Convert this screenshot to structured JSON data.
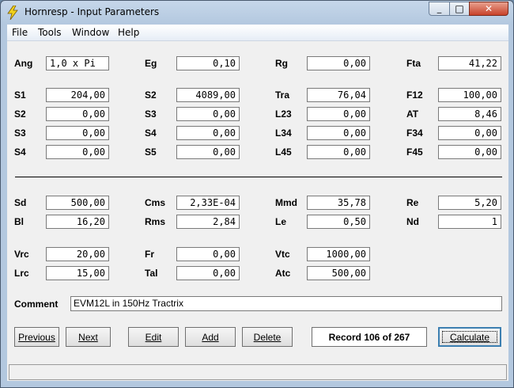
{
  "window": {
    "title": "Hornresp - Input Parameters",
    "close_symbol": "✕",
    "max_symbol": "□",
    "min_symbol": "_"
  },
  "menu": [
    "File",
    "Tools",
    "Window",
    "Help"
  ],
  "params": {
    "Ang": "1,0 x Pi",
    "Eg": "0,10",
    "Rg": "0,00",
    "Fta": "41,22",
    "S1": "204,00",
    "S2": "4089,00",
    "Tra": "76,04",
    "F12": "100,00",
    "S2b": "0,00",
    "S3": "0,00",
    "L23": "0,00",
    "AT": "8,46",
    "S3b": "0,00",
    "S4": "0,00",
    "L34": "0,00",
    "F34": "0,00",
    "S4b": "0,00",
    "S5": "0,00",
    "L45": "0,00",
    "F45": "0,00",
    "Sd": "500,00",
    "Cms": "2,33E-04",
    "Mmd": "35,78",
    "Re": "5,20",
    "Bl": "16,20",
    "Rms": "2,84",
    "Le": "0,50",
    "Nd": "1",
    "Vrc": "20,00",
    "Fr": "0,00",
    "Vtc": "1000,00",
    "Lrc": "15,00",
    "Tal": "0,00",
    "Atc": "500,00"
  },
  "labels": {
    "Ang": "Ang",
    "Eg": "Eg",
    "Rg": "Rg",
    "Fta": "Fta",
    "S1": "S1",
    "S2": "S2",
    "Tra": "Tra",
    "F12": "F12",
    "S3": "S3",
    "L23": "L23",
    "AT": "AT",
    "S4": "S4",
    "L34": "L34",
    "F34": "F34",
    "S5": "S5",
    "L45": "L45",
    "F45": "F45",
    "Sd": "Sd",
    "Cms": "Cms",
    "Mmd": "Mmd",
    "Re": "Re",
    "Bl": "Bl",
    "Rms": "Rms",
    "Le": "Le",
    "Nd": "Nd",
    "Vrc": "Vrc",
    "Fr": "Fr",
    "Vtc": "Vtc",
    "Lrc": "Lrc",
    "Tal": "Tal",
    "Atc": "Atc"
  },
  "comment": {
    "label": "Comment",
    "value": "EVM12L in 150Hz Tractrix"
  },
  "buttons": {
    "previous": "Previous",
    "next": "Next",
    "edit": "Edit",
    "add": "Add",
    "delete": "Delete",
    "calculate": "Calculate"
  },
  "record": "Record 106 of 267",
  "status": ""
}
